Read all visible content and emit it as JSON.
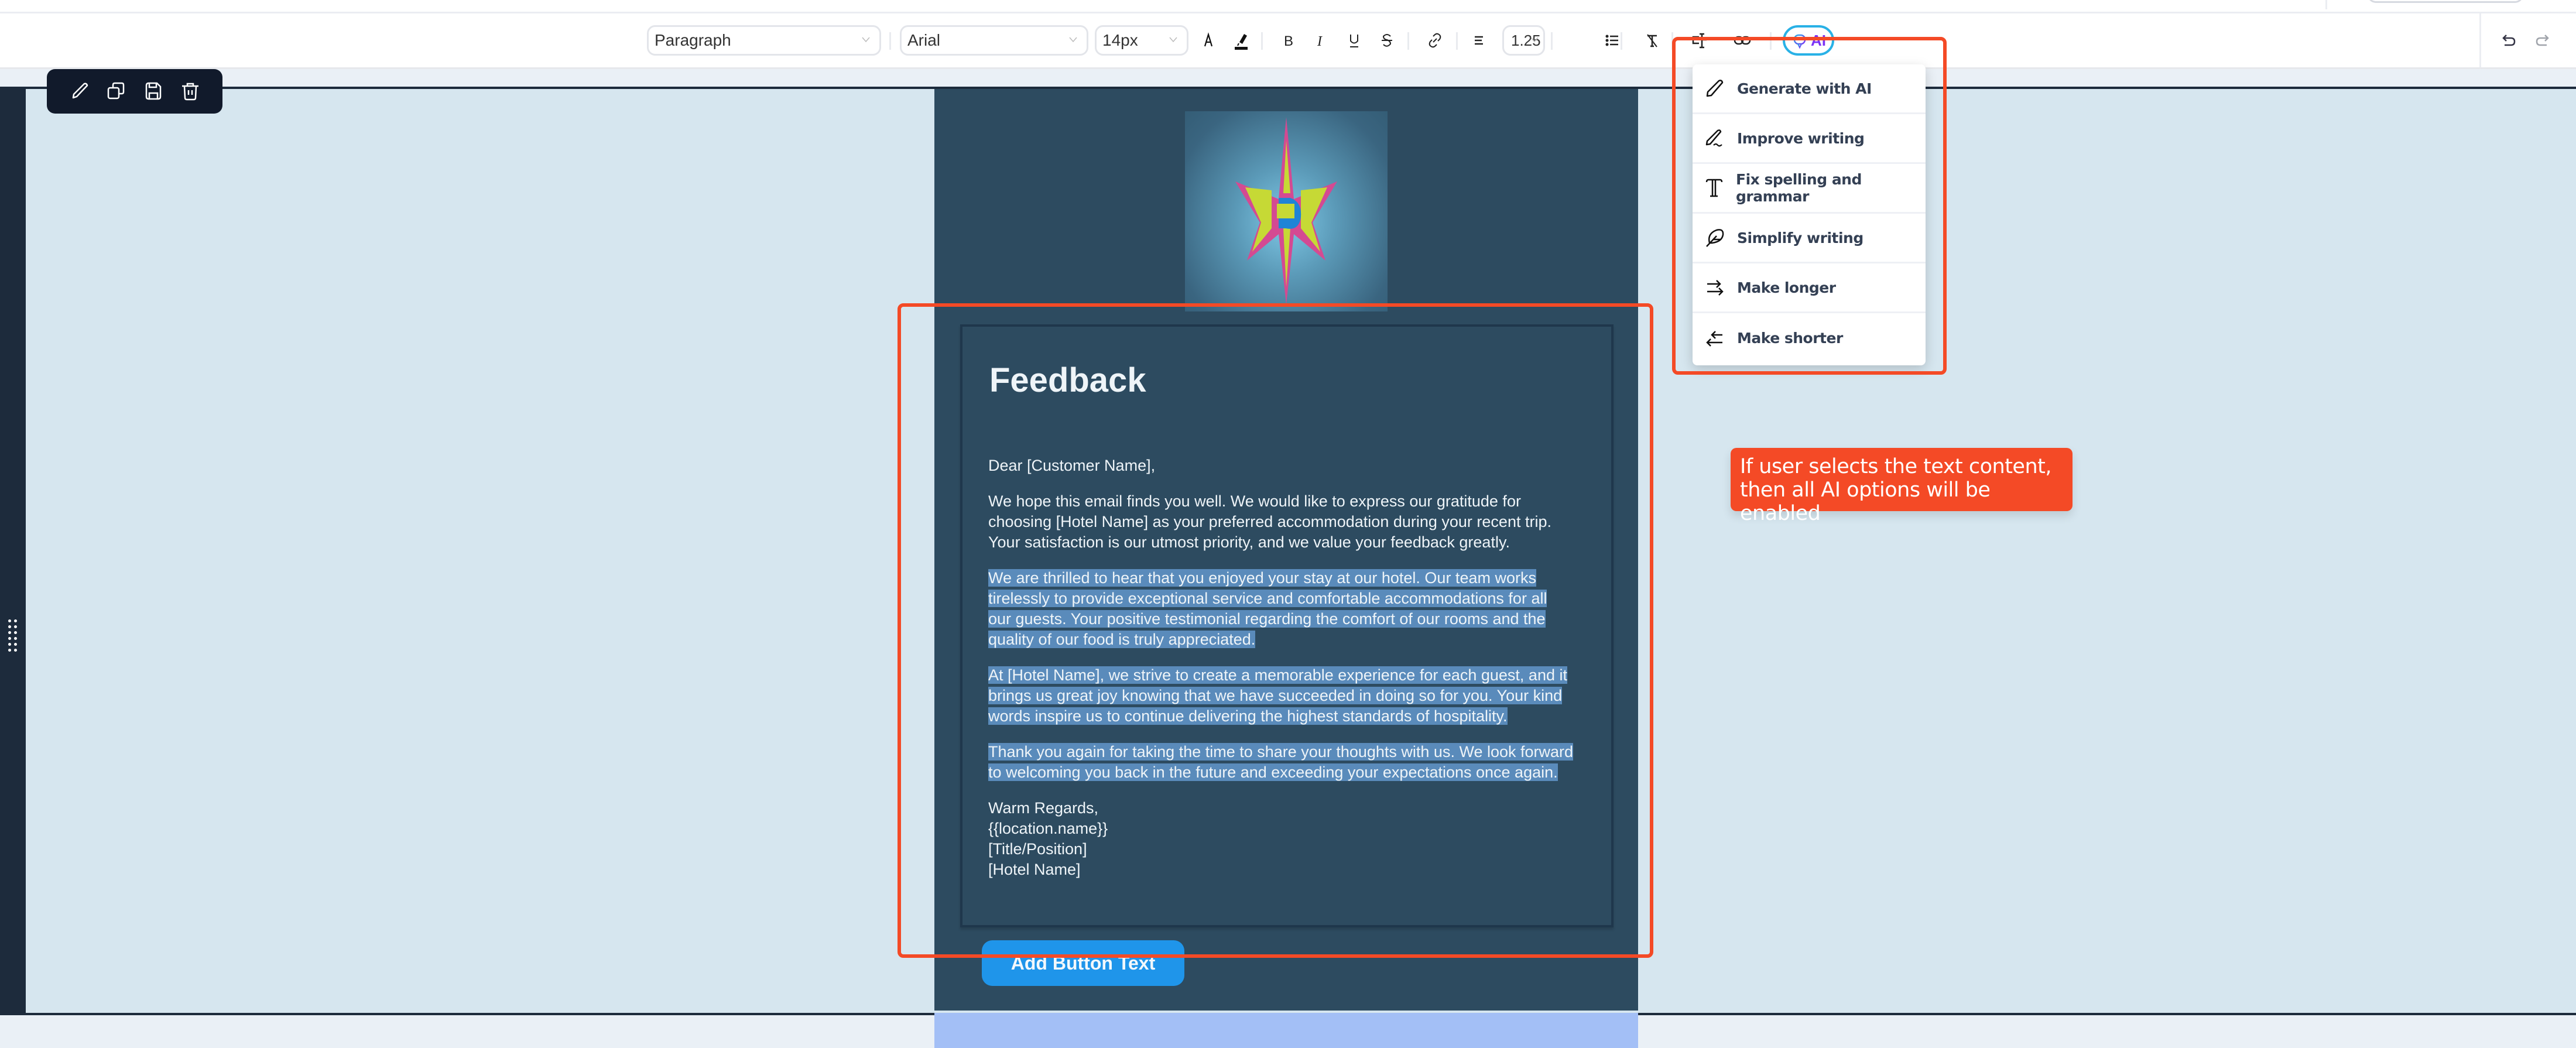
{
  "toolbar": {
    "block_type": "Paragraph",
    "font_family": "Arial",
    "font_size": "14px",
    "line_height": "1.25",
    "ai_label": "AI",
    "icons": [
      "text-color-icon",
      "highlight-icon",
      "bold-icon",
      "italic-icon",
      "underline-icon",
      "strikethrough-icon",
      "link-icon",
      "align-icon",
      "line-height-select",
      "bullet-list-icon",
      "clear-format-icon",
      "text-cursor-icon",
      "unlink-icon",
      "ai-button",
      "undo-icon",
      "redo-icon"
    ]
  },
  "block_toolbar": {
    "actions": [
      "edit",
      "duplicate",
      "save",
      "delete"
    ]
  },
  "ai_menu": {
    "items": [
      {
        "label": "Generate with AI",
        "icon": "pen-icon"
      },
      {
        "label": "Improve writing",
        "icon": "pen-squiggle-icon"
      },
      {
        "label": "Fix spelling and grammar",
        "icon": "text-type-icon"
      },
      {
        "label": "Simplify writing",
        "icon": "feather-icon"
      },
      {
        "label": "Make longer",
        "icon": "arrows-right-icon"
      },
      {
        "label": "Make shorter",
        "icon": "arrows-left-icon"
      }
    ]
  },
  "email": {
    "title": "Feedback",
    "greeting": "Dear [Customer Name],",
    "paragraphs": [
      "We hope this email finds you well. We would like to express our gratitude for choosing [Hotel Name] as your preferred accommodation during your recent trip. Your satisfaction is our utmost priority, and we value your feedback greatly.",
      "We are thrilled to hear that you enjoyed your stay at our hotel. Our team works tirelessly to provide exceptional service and comfortable accommodations for all our guests. Your positive testimonial regarding the comfort of our rooms and the quality of our food is truly appreciated.",
      "At [Hotel Name], we strive to create a memorable experience for each guest, and it brings us great joy knowing that we have succeeded in doing so for you. Your kind words inspire us to continue delivering the highest standards of hospitality.",
      "Thank you again for taking the time to share your thoughts with us. We look forward to welcoming you back in the future and exceeding your expectations once again."
    ],
    "signature": [
      "Warm Regards,",
      "{{location.name}}",
      "[Title/Position]",
      "[Hotel Name]"
    ],
    "button_label": "Add Button Text"
  },
  "annotation": {
    "note": "If user selects the text content, then all AI options will be enabled"
  },
  "colors": {
    "accent_annotation": "#f44a26",
    "email_bg": "#2d4b60",
    "selection": "#5a8bbb",
    "cta": "#1f95ea",
    "ai_border": "#29b1e6",
    "ai_text": "#7b33f5"
  }
}
